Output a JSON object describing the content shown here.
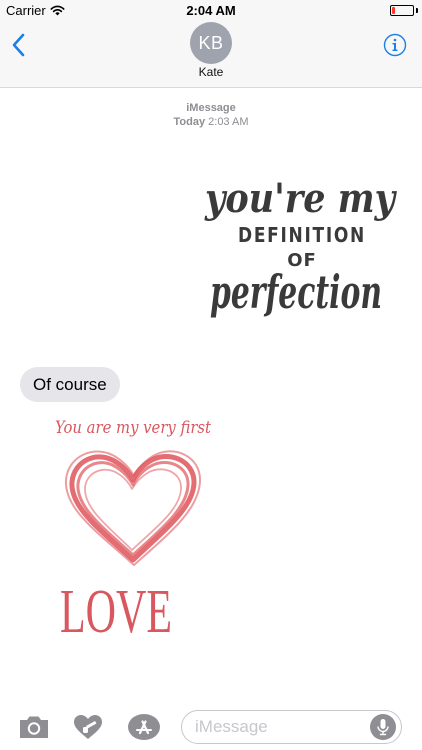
{
  "status_bar": {
    "carrier": "Carrier",
    "time": "2:04 AM",
    "battery_level": 0.15,
    "battery_color": "#ff3b30"
  },
  "nav": {
    "back_icon": "chevron-left-icon",
    "avatar_initials": "KB",
    "contact_name": "Kate",
    "info_icon": "info-icon",
    "accent_color": "#1a7fe8"
  },
  "thread": {
    "service": "iMessage",
    "day": "Today",
    "time": "2:03 AM",
    "messages": [
      {
        "type": "sticker",
        "direction": "outgoing",
        "lines": [
          "you're my",
          "DEFINITION",
          "OF",
          "perfection"
        ]
      },
      {
        "type": "text",
        "direction": "incoming",
        "text": "Of course"
      },
      {
        "type": "sticker",
        "direction": "incoming",
        "lines": [
          "You are my very first",
          "LOVE"
        ],
        "color": "#d9575e"
      }
    ]
  },
  "input_bar": {
    "camera_icon": "camera-icon",
    "digital_touch_icon": "digital-touch-icon",
    "app_store_icon": "app-store-icon",
    "placeholder": "iMessage",
    "mic_icon": "microphone-icon"
  }
}
